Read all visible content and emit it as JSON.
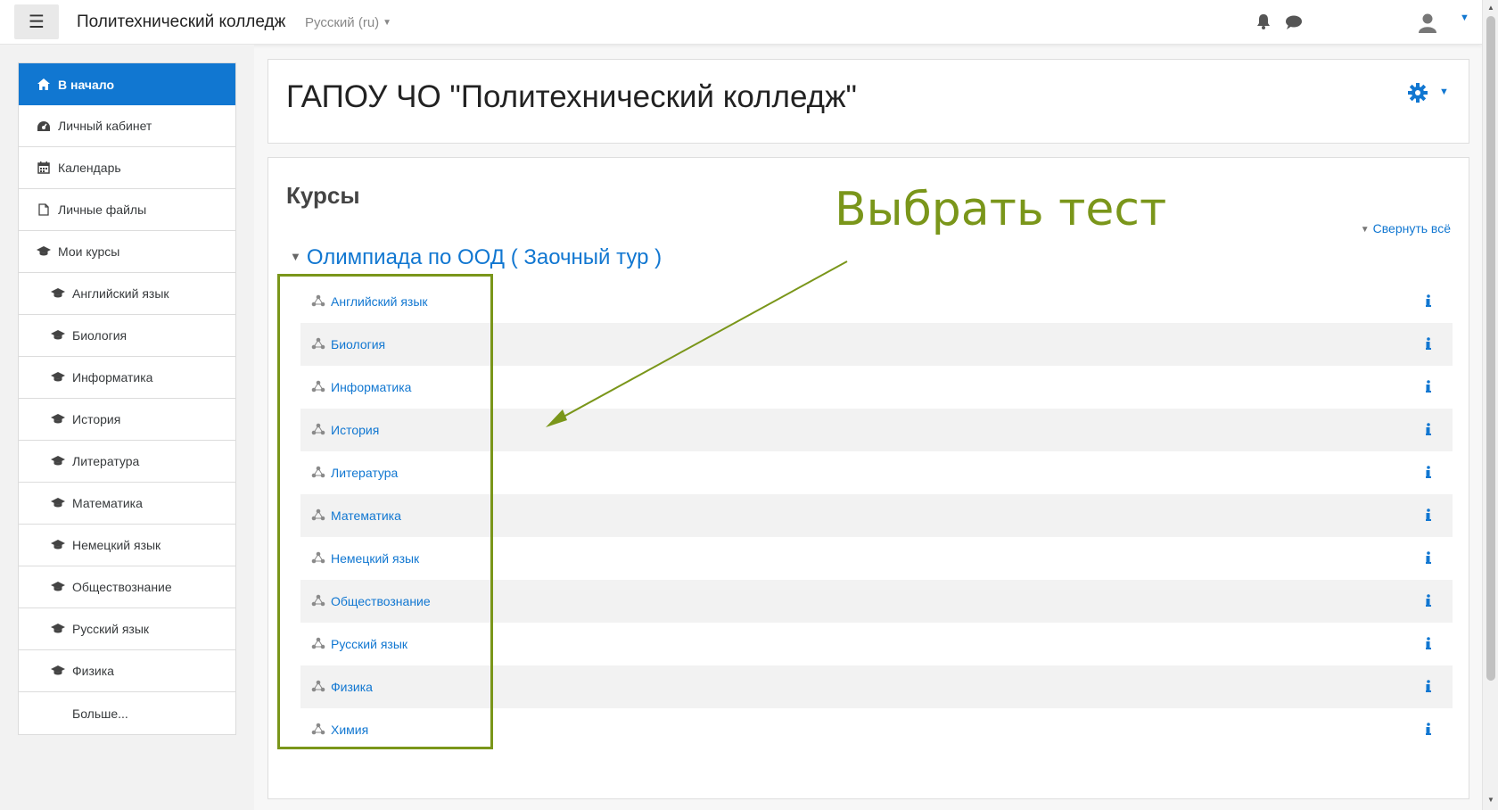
{
  "navbar": {
    "site_name": "Политехнический колледж",
    "language": "Русский ‎(ru)‎"
  },
  "drawer": {
    "items": [
      {
        "label": "В начало",
        "icon": "home-icon"
      },
      {
        "label": "Личный кабинет",
        "icon": "dashboard-icon"
      },
      {
        "label": "Календарь",
        "icon": "calendar-icon"
      },
      {
        "label": "Личные файлы",
        "icon": "file-icon"
      },
      {
        "label": "Мои курсы",
        "icon": "graduation-cap-icon"
      }
    ],
    "courses": [
      "Английский язык",
      "Биология",
      "Информатика",
      "История",
      "Литература",
      "Математика",
      "Немецкий язык",
      "Обществознание",
      "Русский язык",
      "Физика"
    ],
    "more_label": "Больше..."
  },
  "header": {
    "title": "ГАПОУ ЧО \"Политехнический колледж\""
  },
  "courses": {
    "heading": "Курсы",
    "collapse_all": "Свернуть всё",
    "category": "Олимпиада по ООД ( Заочный тур )",
    "items": [
      "Английский язык",
      "Биология",
      "Информатика",
      "История",
      "Литература",
      "Математика",
      "Немецкий язык",
      "Обществознание",
      "Русский язык",
      "Физика",
      "Химия"
    ]
  },
  "annotation": {
    "text": "Выбрать тест",
    "color": "#7a961a"
  },
  "colors": {
    "accent": "#1177d1"
  }
}
